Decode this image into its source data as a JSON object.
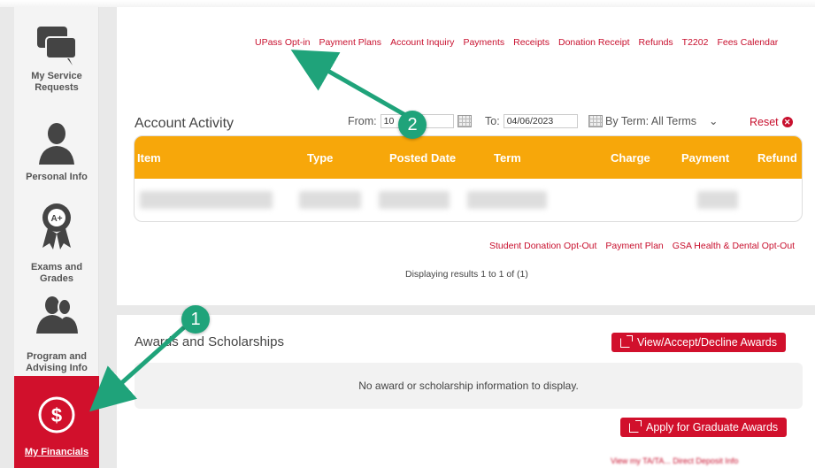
{
  "sidebar": {
    "items": [
      {
        "label": "My Service Requests",
        "icon": "chat-bubbles-icon"
      },
      {
        "label": "Personal Info",
        "icon": "person-icon"
      },
      {
        "label": "Exams and Grades",
        "icon": "award-ribbon-icon"
      },
      {
        "label": "Program and Advising Info",
        "icon": "people-icon"
      },
      {
        "label": "My Financials",
        "icon": "dollar-icon",
        "active": true
      }
    ]
  },
  "top_links": [
    "UPass Opt-in",
    "Payment Plans",
    "Account Inquiry",
    "Payments",
    "Receipts",
    "Donation Receipt",
    "Refunds",
    "T2202",
    "Fees Calendar"
  ],
  "account_activity": {
    "title": "Account Activity",
    "from_label": "From:",
    "from_value": "10",
    "to_label": "To:",
    "to_value": "04/06/2023",
    "term_label": "By Term: All Terms",
    "term_chevron": "⌄",
    "reset_label": "Reset",
    "columns": [
      "Item",
      "Type",
      "Posted Date",
      "Term",
      "Charge",
      "Payment",
      "Refund"
    ]
  },
  "sub_links": [
    "Student Donation Opt-Out",
    "Payment Plan",
    "GSA Health & Dental Opt-Out"
  ],
  "results_text": "Displaying results 1 to 1 of (1)",
  "awards": {
    "title": "Awards and Scholarships",
    "view_button": "View/Accept/Decline Awards",
    "empty_text": "No award or scholarship information to display.",
    "apply_button": "Apply for Graduate Awards",
    "bottom_link": "View my TA/TA... Direct Deposit Info"
  },
  "callouts": {
    "one": "1",
    "two": "2"
  },
  "colors": {
    "accent": "#d1102c",
    "table_header": "#f7a70a",
    "callout": "#1fa37a"
  }
}
